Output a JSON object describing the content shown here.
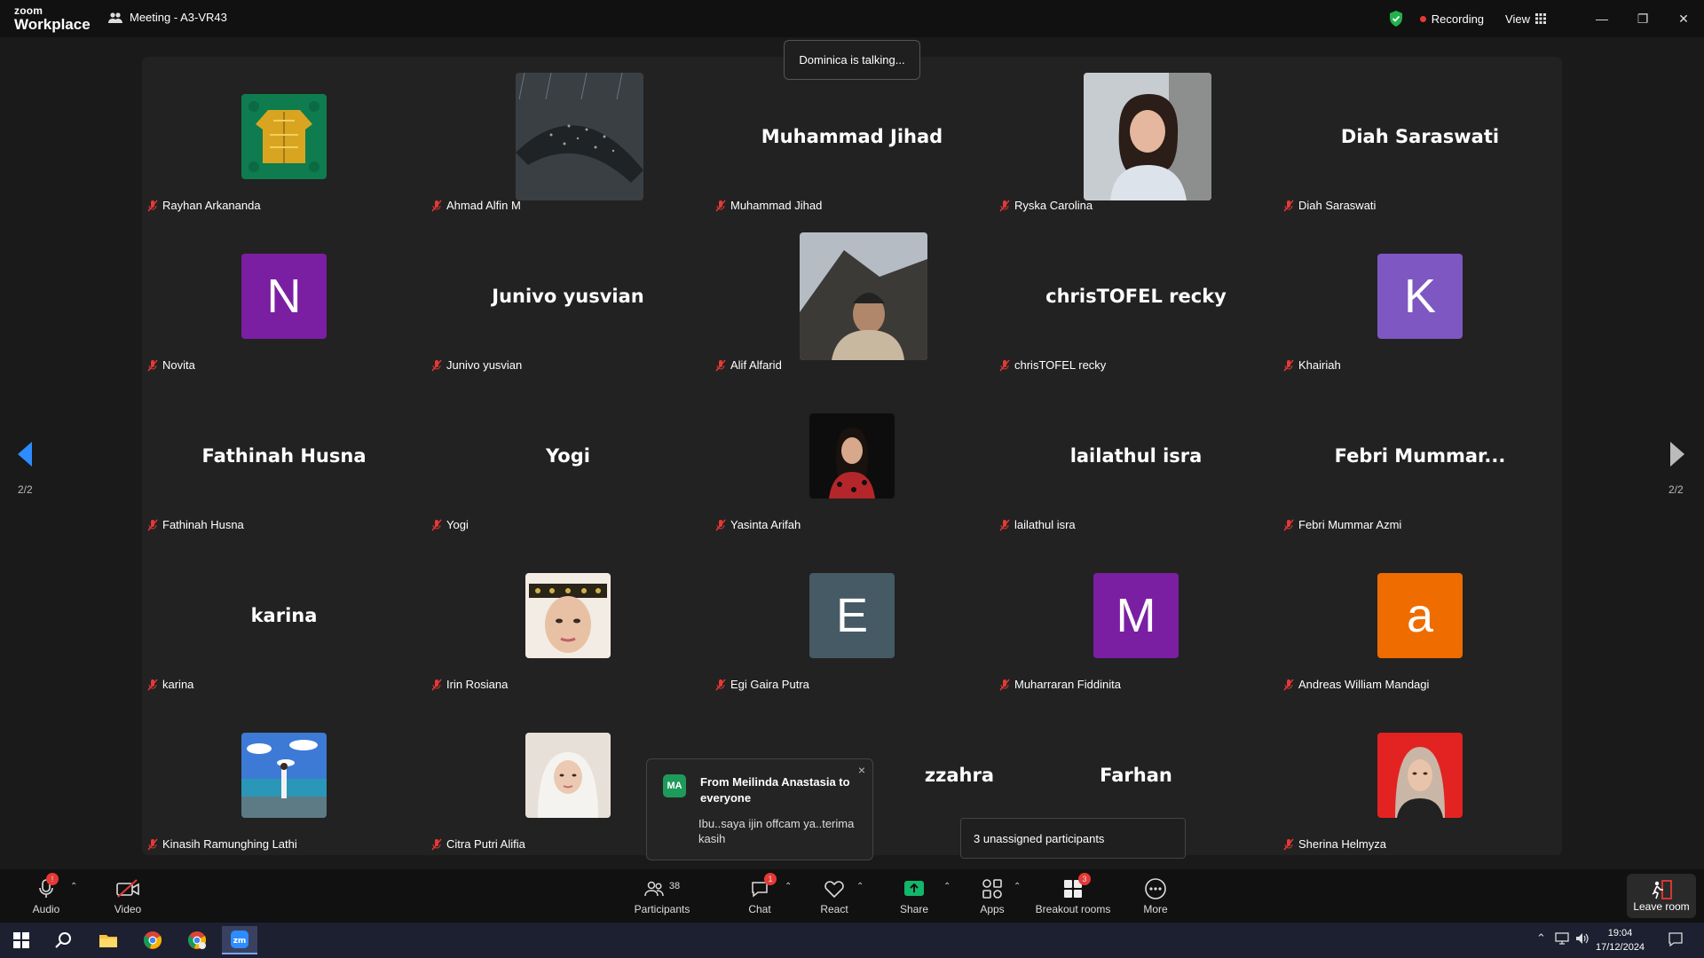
{
  "titlebar": {
    "logo_top": "zoom",
    "logo_bottom": "Workplace",
    "meeting_title": "Meeting - A3-VR43",
    "recording": "Recording",
    "view": "View"
  },
  "talking_indicator": "Dominica is talking...",
  "pager": {
    "left": "2/2",
    "right": "2/2"
  },
  "tiles": [
    {
      "label": "Rayhan Arkananda"
    },
    {
      "label": "Ahmad Alfin M"
    },
    {
      "label": "Muhammad Jihad",
      "big": "Muhammad Jihad"
    },
    {
      "label": "Ryska Carolina"
    },
    {
      "label": "Diah Saraswati",
      "big": "Diah Saraswati"
    },
    {
      "label": "Novita",
      "initial": "N"
    },
    {
      "label": "Junivo yusvian",
      "big": "Junivo yusvian"
    },
    {
      "label": "Alif Alfarid"
    },
    {
      "label": "chrisTOFEL recky",
      "big": "chrisTOFEL recky"
    },
    {
      "label": "Khairiah",
      "initial": "K"
    },
    {
      "label": "Fathinah Husna",
      "big": "Fathinah Husna"
    },
    {
      "label": "Yogi",
      "big": "Yogi"
    },
    {
      "label": "Yasinta Arifah"
    },
    {
      "label": "lailathul isra",
      "big": "lailathul isra"
    },
    {
      "label": "Febri Mummar Azmi",
      "big": "Febri  Mummar..."
    },
    {
      "label": "karina",
      "big": "karina"
    },
    {
      "label": "Irin Rosiana"
    },
    {
      "label": "Egi Gaira Putra",
      "initial": "E"
    },
    {
      "label": "Muharraran Fiddinita",
      "initial": "M"
    },
    {
      "label": "Andreas William Mandagi",
      "initial": "a"
    },
    {
      "label": "Kinasih Ramunghing Lathi"
    },
    {
      "label": "Citra Putri Alifia"
    },
    {
      "label": "",
      "big": "zzahra"
    },
    {
      "label": "",
      "big": "Farhan"
    },
    {
      "label": "Sherina Helmyza"
    }
  ],
  "chat_popup": {
    "initials": "MA",
    "from": "From Meilinda Anastasia to everyone",
    "message": "Ibu..saya ijin offcam ya..terima kasih",
    "close": "×"
  },
  "unassigned": "3 unassigned participants",
  "toolbar": {
    "audio": "Audio",
    "video": "Video",
    "participants": "Participants",
    "participants_count": "38",
    "chat": "Chat",
    "chat_badge": "1",
    "react": "React",
    "share": "Share",
    "apps": "Apps",
    "breakout": "Breakout rooms",
    "breakout_badge": "3",
    "more": "More",
    "leave": "Leave room"
  },
  "taskbar": {
    "time": "19:04",
    "date": "17/12/2024"
  },
  "colors": {
    "novita": "#7b1fa2",
    "khairiah": "#7e57c2",
    "egi": "#455a64",
    "muharraran": "#7b1fa2",
    "andreas": "#ef6c00",
    "share": "#12b76a",
    "recording": "#e53935"
  }
}
